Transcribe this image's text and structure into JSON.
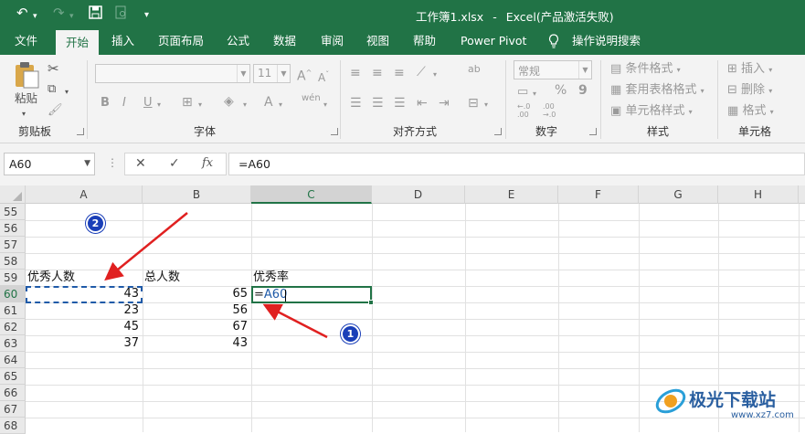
{
  "app": {
    "file_title": "工作簿1.xlsx",
    "separator": "-",
    "app_title": "Excel(产品激活失败)"
  },
  "quick_access": {
    "undo_icon": "undo-icon",
    "redo_icon": "redo-icon",
    "save_icon": "save-icon",
    "preview_icon": "print-preview-icon",
    "customize_icon": "customize-icon"
  },
  "tabs": [
    "文件",
    "开始",
    "插入",
    "页面布局",
    "公式",
    "数据",
    "审阅",
    "视图",
    "帮助",
    "Power Pivot",
    "操作说明搜索"
  ],
  "active_tab": "开始",
  "ribbon": {
    "clipboard": {
      "paste_label": "粘贴",
      "group_label": "剪贴板"
    },
    "font": {
      "font_name": "",
      "font_size": "11",
      "bold": "B",
      "italic": "I",
      "underline": "U",
      "font_color_glyph": "A",
      "wen_glyph": "wén",
      "group_label": "字体"
    },
    "alignment": {
      "group_label": "对齐方式",
      "wrap_glyph": "ab"
    },
    "number": {
      "format_value": "常规",
      "percent": "%",
      "comma": "9",
      "group_label": "数字",
      "inc_decimal": "←.0\n.00",
      "dec_decimal": ".00\n→.0"
    },
    "styles": {
      "conditional_format": "条件格式",
      "table_format": "套用表格格式",
      "cell_style": "单元格样式",
      "group_label": "样式"
    },
    "cells": {
      "insert": "插入",
      "delete": "删除",
      "format": "格式",
      "group_label": "单元格"
    }
  },
  "formula_bar": {
    "name_box": "A60",
    "cancel_glyph": "✕",
    "enter_glyph": "✓",
    "fx_glyph": "fx",
    "formula": "=A60"
  },
  "sheet": {
    "columns": [
      "A",
      "B",
      "C",
      "D",
      "E",
      "F",
      "G",
      "H"
    ],
    "rows": [
      "55",
      "56",
      "57",
      "58",
      "59",
      "60",
      "61",
      "62",
      "63",
      "64",
      "65",
      "66",
      "67",
      "68"
    ],
    "headers": {
      "a59": "优秀人数",
      "b59": "总人数",
      "c59": "优秀率"
    },
    "data": [
      {
        "a": "43",
        "b": "65"
      },
      {
        "a": "23",
        "b": "56"
      },
      {
        "a": "45",
        "b": "67"
      },
      {
        "a": "37",
        "b": "43"
      }
    ],
    "editing_value": "=A60",
    "editing_eq": "=",
    "editing_ref": "A60"
  },
  "annotations": {
    "badge1": "1",
    "badge2": "2"
  },
  "watermark": {
    "cn": "极光下载站",
    "url": "www.xz7.com"
  },
  "colors": {
    "excel_green": "#217346",
    "ref_blue": "#1f5aa8",
    "arrow_red": "#e02020",
    "badge_blue": "#1a3fb8"
  }
}
